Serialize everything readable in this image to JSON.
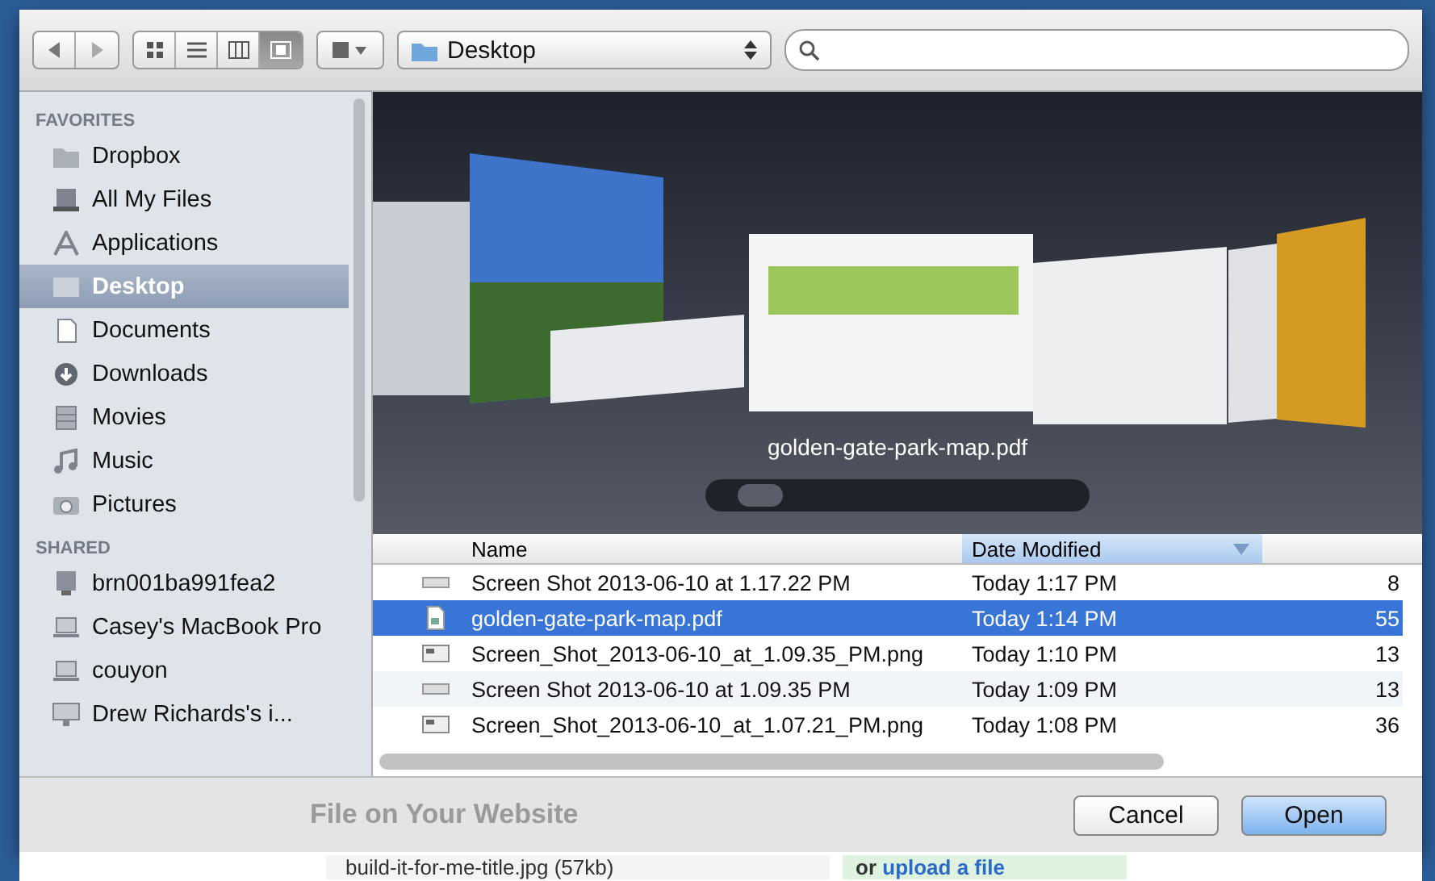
{
  "toolbar": {
    "view_modes": [
      {
        "kind": "icons",
        "selected": false
      },
      {
        "kind": "list",
        "selected": false
      },
      {
        "kind": "columns",
        "selected": false
      },
      {
        "kind": "coverflow",
        "selected": true
      }
    ],
    "location": "Desktop"
  },
  "sidebar": {
    "sections": [
      {
        "heading": "FAVORITES",
        "items": [
          {
            "label": "Dropbox",
            "kind": "folder",
            "selected": false
          },
          {
            "label": "All My Files",
            "kind": "drive",
            "selected": false
          },
          {
            "label": "Applications",
            "kind": "apps",
            "selected": false
          },
          {
            "label": "Desktop",
            "kind": "desktop",
            "selected": true
          },
          {
            "label": "Documents",
            "kind": "documents",
            "selected": false
          },
          {
            "label": "Downloads",
            "kind": "downloads",
            "selected": false
          },
          {
            "label": "Movies",
            "kind": "movies",
            "selected": false
          },
          {
            "label": "Music",
            "kind": "music",
            "selected": false
          },
          {
            "label": "Pictures",
            "kind": "pictures",
            "selected": false
          }
        ]
      },
      {
        "heading": "SHARED",
        "items": [
          {
            "label": "brn001ba991fea2",
            "kind": "server",
            "selected": false
          },
          {
            "label": "Casey's MacBook Pro",
            "kind": "laptop",
            "selected": false
          },
          {
            "label": "couyon",
            "kind": "laptop",
            "selected": false
          },
          {
            "label": "Drew Richards's i...",
            "kind": "monitor",
            "selected": false
          }
        ]
      }
    ]
  },
  "preview": {
    "caption": "golden-gate-park-map.pdf"
  },
  "file_list": {
    "columns": [
      {
        "label": "Name",
        "selected": false
      },
      {
        "label": "Date Modified",
        "selected": true
      }
    ],
    "rows": [
      {
        "name": "Screen Shot 2013-06-10 at 1.17.22 PM",
        "date": "Today 1:17 PM",
        "size": "8",
        "kind": "screenshot",
        "selected": false
      },
      {
        "name": "golden-gate-park-map.pdf",
        "date": "Today 1:14 PM",
        "size": "55",
        "kind": "pdf",
        "selected": true
      },
      {
        "name": "Screen_Shot_2013-06-10_at_1.09.35_PM.png",
        "date": "Today 1:10 PM",
        "size": "13",
        "kind": "image",
        "selected": false
      },
      {
        "name": "Screen Shot 2013-06-10 at 1.09.35 PM",
        "date": "Today 1:09 PM",
        "size": "13",
        "kind": "screenshot",
        "selected": false
      },
      {
        "name": "Screen_Shot_2013-06-10_at_1.07.21_PM.png",
        "date": "Today 1:08 PM",
        "size": "36",
        "kind": "image",
        "selected": false
      }
    ]
  },
  "buttons": [
    {
      "label": "Cancel",
      "default": false
    },
    {
      "label": "Open",
      "default": true
    }
  ],
  "background_page": {
    "heading": "File on Your Website",
    "file_field": "build-it-for-me-title.jpg (57kb)",
    "link_prefix": "or",
    "link": "upload a file"
  }
}
